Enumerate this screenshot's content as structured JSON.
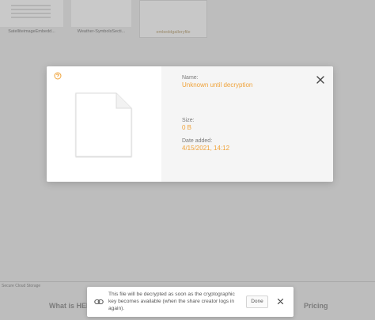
{
  "background": {
    "thumbnails": [
      {
        "caption": "SatelliteimageEmbedd..."
      },
      {
        "caption": "Weather-SymbolsSecti..."
      },
      {
        "caption": "embeddgalleryfile"
      }
    ],
    "footer_small": "Secure Cloud Storage",
    "nav_left": "What is HEIC?",
    "nav_right": "Pricing",
    "dot_colors": [
      "#7a7a7a",
      "#c8941e",
      "#4d8a4d",
      "#6b6b6b",
      "#c8941e",
      "#4d8a4d"
    ]
  },
  "modal": {
    "brand_icon": "brand-logo-icon",
    "file_icon": "file-icon",
    "close_icon": "close-icon",
    "fields": {
      "name_label": "Name:",
      "name_value": "Unknown until decryption",
      "size_label": "Size:",
      "size_value": "0 B",
      "date_label": "Date added:",
      "date_value": "4/15/2021, 14:12"
    },
    "accent_color": "#f0a33a"
  },
  "toast": {
    "link_icon": "link-icon",
    "message": "This file will be decrypted as soon as the cryptographic key becomes available (when the share creator logs in again).",
    "done_label": "Done",
    "close_icon": "close-icon"
  }
}
